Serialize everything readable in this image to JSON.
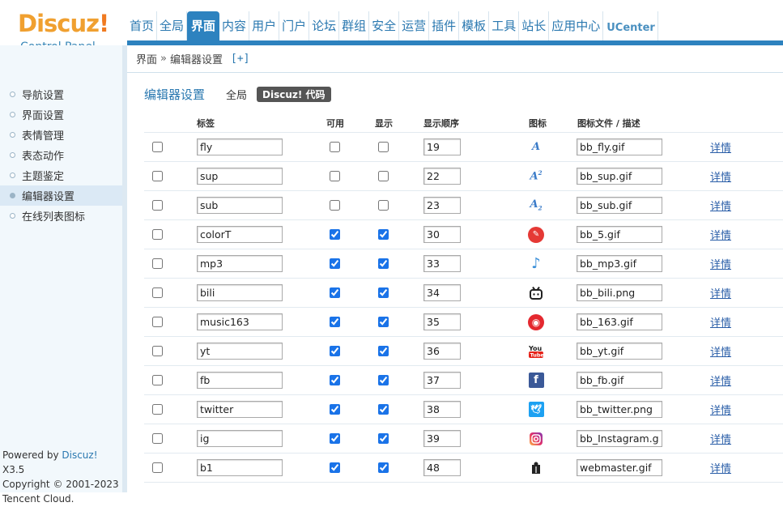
{
  "logo": {
    "brand": "Discuz",
    "bang": "!",
    "subtitle": "Control Panel"
  },
  "topnav": [
    {
      "label": "首页",
      "active": false
    },
    {
      "label": "全局",
      "active": false
    },
    {
      "label": "界面",
      "active": true
    },
    {
      "label": "内容",
      "active": false
    },
    {
      "label": "用户",
      "active": false
    },
    {
      "label": "门户",
      "active": false
    },
    {
      "label": "论坛",
      "active": false
    },
    {
      "label": "群组",
      "active": false
    },
    {
      "label": "安全",
      "active": false
    },
    {
      "label": "运营",
      "active": false
    },
    {
      "label": "插件",
      "active": false
    },
    {
      "label": "模板",
      "active": false
    },
    {
      "label": "工具",
      "active": false
    },
    {
      "label": "站长",
      "active": false
    },
    {
      "label": "应用中心",
      "active": false
    },
    {
      "label": "UCenter",
      "active": false
    }
  ],
  "breadcrumb": {
    "parent": "界面",
    "sep": "»",
    "current": "编辑器设置",
    "add": "[+]"
  },
  "sidebar": {
    "items": [
      {
        "label": "导航设置",
        "active": false
      },
      {
        "label": "界面设置",
        "active": false
      },
      {
        "label": "表情管理",
        "active": false
      },
      {
        "label": "表态动作",
        "active": false
      },
      {
        "label": "主题鉴定",
        "active": false
      },
      {
        "label": "编辑器设置",
        "active": true
      },
      {
        "label": "在线列表图标",
        "active": false
      }
    ],
    "footer": {
      "powered": "Powered by ",
      "brand": "Discuz!",
      "version": " X3.5",
      "copyright": "Copyright © 2001-2023",
      "company": "Tencent Cloud."
    }
  },
  "tabs": {
    "title": "编辑器设置",
    "items": [
      "全局",
      "Discuz! 代码"
    ],
    "current_index": 1
  },
  "table": {
    "headers": {
      "label": "标签",
      "available": "可用",
      "display": "显示",
      "order": "显示顺序",
      "icon": "图标",
      "file": "图标文件 / 描述"
    },
    "detail_label": "详情",
    "rows": [
      {
        "label": "fly",
        "available": false,
        "display": false,
        "order": "19",
        "icon": "fly-icon",
        "file": "bb_fly.gif"
      },
      {
        "label": "sup",
        "available": false,
        "display": false,
        "order": "22",
        "icon": "sup-icon",
        "file": "bb_sup.gif"
      },
      {
        "label": "sub",
        "available": false,
        "display": false,
        "order": "23",
        "icon": "sub-icon",
        "file": "bb_sub.gif"
      },
      {
        "label": "colorT",
        "available": true,
        "display": true,
        "order": "30",
        "icon": "color-icon",
        "file": "bb_5.gif"
      },
      {
        "label": "mp3",
        "available": true,
        "display": true,
        "order": "33",
        "icon": "music-note-icon",
        "file": "bb_mp3.gif"
      },
      {
        "label": "bili",
        "available": true,
        "display": true,
        "order": "34",
        "icon": "bilibili-icon",
        "file": "bb_bili.png"
      },
      {
        "label": "music163",
        "available": true,
        "display": true,
        "order": "35",
        "icon": "netease-music-icon",
        "file": "bb_163.gif"
      },
      {
        "label": "yt",
        "available": true,
        "display": true,
        "order": "36",
        "icon": "youtube-icon",
        "file": "bb_yt.gif"
      },
      {
        "label": "fb",
        "available": true,
        "display": true,
        "order": "37",
        "icon": "facebook-icon",
        "file": "bb_fb.gif"
      },
      {
        "label": "twitter",
        "available": true,
        "display": true,
        "order": "38",
        "icon": "twitter-icon",
        "file": "bb_twitter.png"
      },
      {
        "label": "ig",
        "available": true,
        "display": true,
        "order": "39",
        "icon": "instagram-icon",
        "file": "bb_Instagram.gi"
      },
      {
        "label": "b1",
        "available": true,
        "display": true,
        "order": "48",
        "icon": "webmaster-icon",
        "file": "webmaster.gif"
      }
    ]
  },
  "colors": {
    "accent": "#2d82bf",
    "brand_orange": "#f0a030",
    "link": "#2a5ea8",
    "sidebar_bg": "#f2f8fc"
  }
}
